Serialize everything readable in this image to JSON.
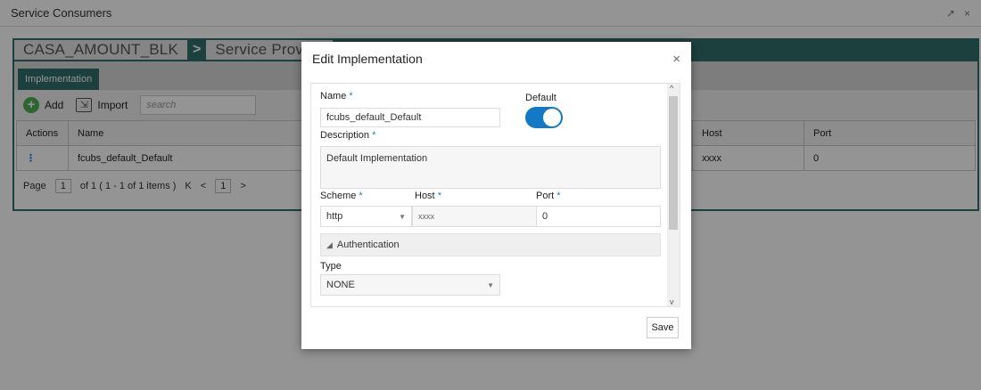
{
  "window": {
    "title": "Service Consumers",
    "controls": [
      "↗",
      "×"
    ]
  },
  "breadcrumb": {
    "first": "CASA_AMOUNT_BLK",
    "separator": ">",
    "second": "Service Provide"
  },
  "tabs": [
    {
      "label": "Implementation"
    }
  ],
  "toolbar": {
    "add_label": "Add",
    "import_label": "Import",
    "search_placeholder": "search"
  },
  "table": {
    "headers": [
      "Actions",
      "Name",
      "Host",
      "Port"
    ],
    "rows": [
      {
        "actions": "⋮",
        "name": "fcubs_default_Default",
        "host": "xxxx",
        "port": "0"
      }
    ]
  },
  "pager": {
    "page_label": "Page",
    "page_value": "1",
    "of_text": "of 1  ( 1 - 1 of 1 items )",
    "first": "K",
    "prev": "<",
    "current": "1",
    "next": ">"
  },
  "dialog": {
    "title": "Edit Implementation",
    "close": "×",
    "name_label": "Name",
    "name_value": "fcubs_default_Default",
    "default_label": "Default",
    "default_on": true,
    "description_label": "Description",
    "description_value": "Default Implementation",
    "scheme_label": "Scheme",
    "scheme_value": "http",
    "host_label": "Host",
    "host_value": "xxxx",
    "port_label": "Port",
    "port_value": "0",
    "auth_section": "Authentication",
    "type_label": "Type",
    "type_value": "NONE",
    "required_mark": "*",
    "save_label": "Save"
  },
  "colors": {
    "accent": "#2f6f6b",
    "toggle": "#1479c4",
    "required": "#2b7bb9"
  }
}
